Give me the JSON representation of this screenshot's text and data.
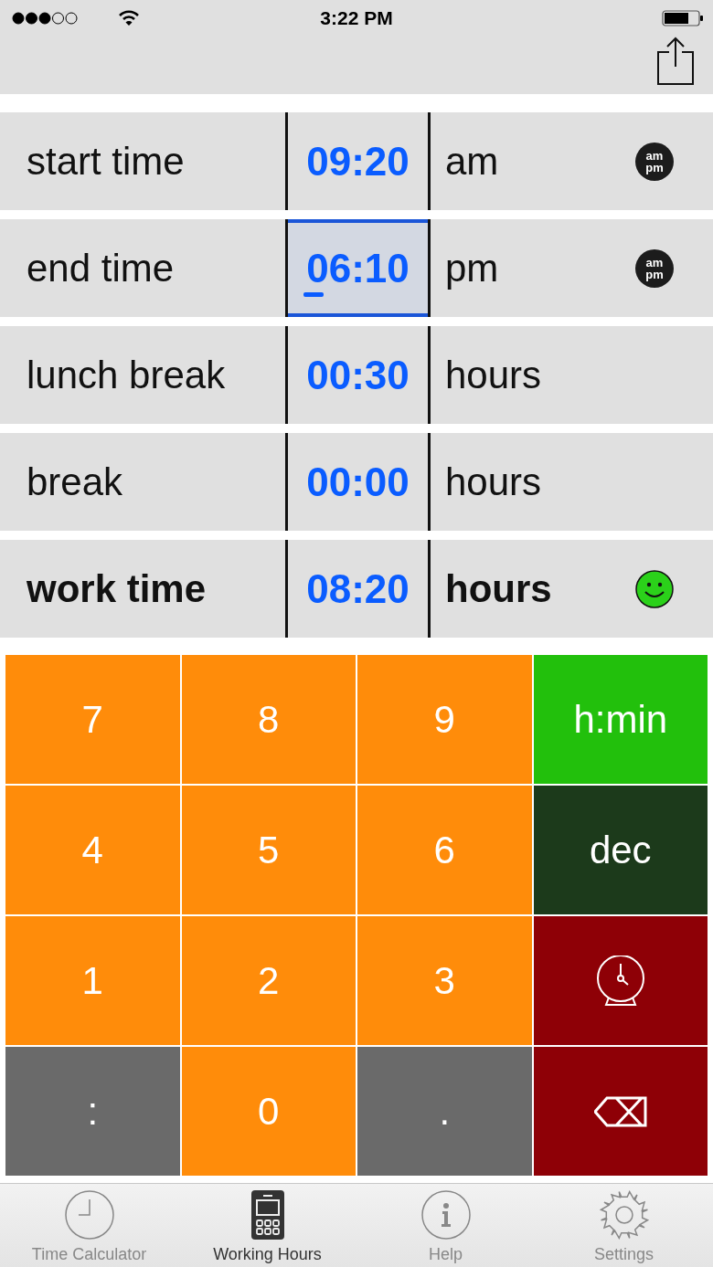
{
  "status_bar": {
    "time": "3:22 PM"
  },
  "rows": [
    {
      "label": "start time",
      "value": "09:20",
      "unit": "am",
      "bold": false,
      "selected": false,
      "badge": {
        "kind": "ampm",
        "top": "am",
        "bottom": "pm"
      }
    },
    {
      "label": "end time",
      "value": "06:10",
      "unit": "pm",
      "bold": false,
      "selected": true,
      "badge": {
        "kind": "ampm",
        "top": "am",
        "bottom": "pm"
      }
    },
    {
      "label": "lunch break",
      "value": "00:30",
      "unit": "hours",
      "bold": false,
      "selected": false
    },
    {
      "label": "break",
      "value": "00:00",
      "unit": "hours",
      "bold": false,
      "selected": false
    },
    {
      "label": "work time",
      "value": "08:20",
      "unit": "hours",
      "bold": true,
      "selected": false,
      "badge": {
        "kind": "smiley"
      }
    }
  ],
  "keypad": [
    {
      "kind": "text",
      "label": "7",
      "color": "#ff8c0a"
    },
    {
      "kind": "text",
      "label": "8",
      "color": "#ff8c0a"
    },
    {
      "kind": "text",
      "label": "9",
      "color": "#ff8c0a"
    },
    {
      "kind": "text",
      "label": "h:min",
      "color": "#22c00c"
    },
    {
      "kind": "text",
      "label": "4",
      "color": "#ff8c0a"
    },
    {
      "kind": "text",
      "label": "5",
      "color": "#ff8c0a"
    },
    {
      "kind": "text",
      "label": "6",
      "color": "#ff8c0a"
    },
    {
      "kind": "text",
      "label": "dec",
      "color": "#1c3a1b"
    },
    {
      "kind": "text",
      "label": "1",
      "color": "#ff8c0a"
    },
    {
      "kind": "text",
      "label": "2",
      "color": "#ff8c0a"
    },
    {
      "kind": "text",
      "label": "3",
      "color": "#ff8c0a"
    },
    {
      "kind": "clock",
      "color": "#8e0006"
    },
    {
      "kind": "text",
      "label": ":",
      "color": "#6a6a6a"
    },
    {
      "kind": "text",
      "label": "0",
      "color": "#ff8c0a"
    },
    {
      "kind": "text",
      "label": ".",
      "color": "#6a6a6a"
    },
    {
      "kind": "backspace",
      "color": "#8e0006"
    }
  ],
  "tabs": [
    {
      "label": "Time Calculator",
      "kind": "clock",
      "selected": false
    },
    {
      "label": "Working Hours",
      "kind": "calculator",
      "selected": true
    },
    {
      "label": "Help",
      "kind": "info",
      "selected": false
    },
    {
      "label": "Settings",
      "kind": "gear",
      "selected": false
    }
  ]
}
